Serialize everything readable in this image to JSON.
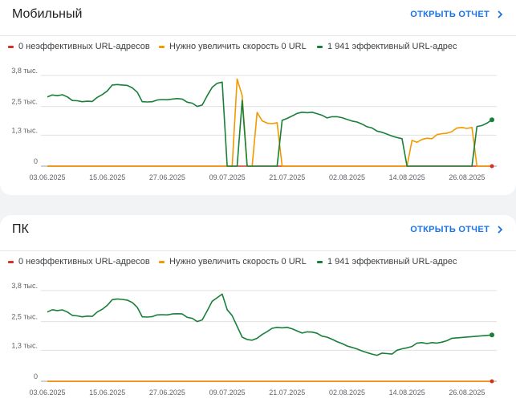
{
  "colors": {
    "ineffective": "#d93025",
    "improve": "#f29900",
    "effective": "#188038",
    "link": "#1a73e8"
  },
  "icons": {
    "open_report": "chevron-right-icon"
  },
  "cards": [
    {
      "title": "Мобильный",
      "open_report_label": "ОТКРЫТЬ ОТЧЕТ",
      "legend": [
        "0 неэффективных URL-адресов",
        "Нужно увеличить скорость 0 URL",
        "1 941 эффективный URL-адрес"
      ],
      "chart_data": {
        "type": "line",
        "x_tick_labels": [
          "03.06.2025",
          "15.06.2025",
          "27.06.2025",
          "09.07.2025",
          "21.07.2025",
          "02.08.2025",
          "14.08.2025",
          "26.08.2025"
        ],
        "y_tick_labels": [
          "3,8 тыс.",
          "2,5 тыс.",
          "1,3 тыс.",
          "0"
        ],
        "y_tick_values": [
          3800,
          2500,
          1300,
          0
        ],
        "ylim": [
          0,
          4000
        ],
        "grid": true,
        "legend_position": "top",
        "series": [
          {
            "name": "0 неэффективных URL-адресов",
            "color": "#d93025",
            "points": [
              [
                "03.06.2025",
                0
              ],
              [
                "31.08.2025",
                0
              ]
            ]
          },
          {
            "name": "Нужно увеличить скорость 0 URL",
            "color": "#f29900",
            "points": [
              [
                "03.06.2025",
                0
              ],
              [
                "10.07.2025",
                0
              ],
              [
                "11.07.2025",
                3650
              ],
              [
                "12.07.2025",
                2950
              ],
              [
                "13.07.2025",
                0
              ],
              [
                "14.07.2025",
                0
              ],
              [
                "15.07.2025",
                2250
              ],
              [
                "16.07.2025",
                1900
              ],
              [
                "17.07.2025",
                1800
              ],
              [
                "18.07.2025",
                1780
              ],
              [
                "19.07.2025",
                1820
              ],
              [
                "20.07.2025",
                0
              ],
              [
                "14.08.2025",
                0
              ],
              [
                "15.08.2025",
                1080
              ],
              [
                "16.08.2025",
                1000
              ],
              [
                "17.08.2025",
                1120
              ],
              [
                "18.08.2025",
                1170
              ],
              [
                "19.08.2025",
                1150
              ],
              [
                "20.08.2025",
                1320
              ],
              [
                "21.08.2025",
                1360
              ],
              [
                "22.08.2025",
                1380
              ],
              [
                "23.08.2025",
                1450
              ],
              [
                "24.08.2025",
                1600
              ],
              [
                "25.08.2025",
                1620
              ],
              [
                "26.08.2025",
                1580
              ],
              [
                "27.08.2025",
                1620
              ],
              [
                "28.08.2025",
                0
              ],
              [
                "31.08.2025",
                0
              ]
            ]
          },
          {
            "name": "1 941 эффективный URL-адрес",
            "color": "#188038",
            "points": [
              [
                "03.06.2025",
                2900
              ],
              [
                "04.06.2025",
                2980
              ],
              [
                "05.06.2025",
                2950
              ],
              [
                "06.06.2025",
                2990
              ],
              [
                "07.06.2025",
                2900
              ],
              [
                "08.06.2025",
                2750
              ],
              [
                "09.06.2025",
                2740
              ],
              [
                "10.06.2025",
                2700
              ],
              [
                "11.06.2025",
                2720
              ],
              [
                "12.06.2025",
                2710
              ],
              [
                "13.06.2025",
                2880
              ],
              [
                "14.06.2025",
                3000
              ],
              [
                "15.06.2025",
                3150
              ],
              [
                "16.06.2025",
                3400
              ],
              [
                "17.06.2025",
                3420
              ],
              [
                "18.06.2025",
                3400
              ],
              [
                "19.06.2025",
                3380
              ],
              [
                "20.06.2025",
                3280
              ],
              [
                "21.06.2025",
                3100
              ],
              [
                "22.06.2025",
                2700
              ],
              [
                "23.06.2025",
                2690
              ],
              [
                "24.06.2025",
                2700
              ],
              [
                "25.06.2025",
                2770
              ],
              [
                "26.06.2025",
                2790
              ],
              [
                "27.06.2025",
                2780
              ],
              [
                "28.06.2025",
                2810
              ],
              [
                "29.06.2025",
                2830
              ],
              [
                "30.06.2025",
                2810
              ],
              [
                "01.07.2025",
                2680
              ],
              [
                "02.07.2025",
                2640
              ],
              [
                "03.07.2025",
                2500
              ],
              [
                "04.07.2025",
                2560
              ],
              [
                "05.07.2025",
                2950
              ],
              [
                "06.07.2025",
                3300
              ],
              [
                "07.07.2025",
                3470
              ],
              [
                "08.07.2025",
                3520
              ],
              [
                "09.07.2025",
                0
              ],
              [
                "11.07.2025",
                0
              ],
              [
                "12.07.2025",
                2750
              ],
              [
                "13.07.2025",
                0
              ],
              [
                "19.07.2025",
                0
              ],
              [
                "20.07.2025",
                1920
              ],
              [
                "21.07.2025",
                2000
              ],
              [
                "22.07.2025",
                2100
              ],
              [
                "23.07.2025",
                2210
              ],
              [
                "24.07.2025",
                2260
              ],
              [
                "25.07.2025",
                2240
              ],
              [
                "26.07.2025",
                2260
              ],
              [
                "27.07.2025",
                2200
              ],
              [
                "28.07.2025",
                2130
              ],
              [
                "29.07.2025",
                2020
              ],
              [
                "30.07.2025",
                2070
              ],
              [
                "31.07.2025",
                2070
              ],
              [
                "01.08.2025",
                2030
              ],
              [
                "02.08.2025",
                1960
              ],
              [
                "03.08.2025",
                1890
              ],
              [
                "04.08.2025",
                1850
              ],
              [
                "05.08.2025",
                1760
              ],
              [
                "06.08.2025",
                1650
              ],
              [
                "07.08.2025",
                1600
              ],
              [
                "08.08.2025",
                1470
              ],
              [
                "09.08.2025",
                1420
              ],
              [
                "10.08.2025",
                1340
              ],
              [
                "11.08.2025",
                1260
              ],
              [
                "12.08.2025",
                1200
              ],
              [
                "13.08.2025",
                1150
              ],
              [
                "14.08.2025",
                0
              ],
              [
                "27.08.2025",
                0
              ],
              [
                "28.08.2025",
                1660
              ],
              [
                "29.08.2025",
                1700
              ],
              [
                "30.08.2025",
                1800
              ],
              [
                "31.08.2025",
                1941
              ]
            ]
          }
        ]
      }
    },
    {
      "title": "ПК",
      "open_report_label": "ОТКРЫТЬ ОТЧЕТ",
      "legend": [
        "0 неэффективных URL-адресов",
        "Нужно увеличить скорость 0 URL",
        "1 941 эффективный URL-адрес"
      ],
      "chart_data": {
        "type": "line",
        "x_tick_labels": [
          "03.06.2025",
          "15.06.2025",
          "27.06.2025",
          "09.07.2025",
          "21.07.2025",
          "02.08.2025",
          "14.08.2025",
          "26.08.2025"
        ],
        "y_tick_labels": [
          "3,8 тыс.",
          "2,5 тыс.",
          "1,3 тыс.",
          "0"
        ],
        "y_tick_values": [
          3800,
          2500,
          1300,
          0
        ],
        "ylim": [
          0,
          4000
        ],
        "grid": true,
        "legend_position": "top",
        "series": [
          {
            "name": "0 неэффективных URL-адресов",
            "color": "#d93025",
            "points": [
              [
                "03.06.2025",
                0
              ],
              [
                "31.08.2025",
                0
              ]
            ]
          },
          {
            "name": "Нужно увеличить скорость 0 URL",
            "color": "#f29900",
            "points": [
              [
                "03.06.2025",
                0
              ],
              [
                "31.08.2025",
                0
              ]
            ]
          },
          {
            "name": "1 941 эффективный URL-адрес",
            "color": "#188038",
            "points": [
              [
                "03.06.2025",
                2900
              ],
              [
                "04.06.2025",
                3000
              ],
              [
                "05.06.2025",
                2960
              ],
              [
                "06.06.2025",
                2990
              ],
              [
                "07.06.2025",
                2900
              ],
              [
                "08.06.2025",
                2760
              ],
              [
                "09.06.2025",
                2740
              ],
              [
                "10.06.2025",
                2700
              ],
              [
                "11.06.2025",
                2730
              ],
              [
                "12.06.2025",
                2720
              ],
              [
                "13.06.2025",
                2900
              ],
              [
                "14.06.2025",
                3020
              ],
              [
                "15.06.2025",
                3180
              ],
              [
                "16.06.2025",
                3420
              ],
              [
                "17.06.2025",
                3450
              ],
              [
                "18.06.2025",
                3430
              ],
              [
                "19.06.2025",
                3400
              ],
              [
                "20.06.2025",
                3300
              ],
              [
                "21.06.2025",
                3100
              ],
              [
                "22.06.2025",
                2700
              ],
              [
                "23.06.2025",
                2690
              ],
              [
                "24.06.2025",
                2710
              ],
              [
                "25.06.2025",
                2780
              ],
              [
                "26.06.2025",
                2790
              ],
              [
                "27.06.2025",
                2780
              ],
              [
                "28.06.2025",
                2820
              ],
              [
                "29.06.2025",
                2830
              ],
              [
                "30.06.2025",
                2820
              ],
              [
                "01.07.2025",
                2680
              ],
              [
                "02.07.2025",
                2640
              ],
              [
                "03.07.2025",
                2500
              ],
              [
                "04.07.2025",
                2570
              ],
              [
                "05.07.2025",
                2950
              ],
              [
                "06.07.2025",
                3350
              ],
              [
                "07.07.2025",
                3500
              ],
              [
                "08.07.2025",
                3650
              ],
              [
                "09.07.2025",
                3000
              ],
              [
                "10.07.2025",
                2750
              ],
              [
                "11.07.2025",
                2300
              ],
              [
                "12.07.2025",
                1850
              ],
              [
                "13.07.2025",
                1750
              ],
              [
                "14.07.2025",
                1720
              ],
              [
                "15.07.2025",
                1800
              ],
              [
                "16.07.2025",
                1960
              ],
              [
                "17.07.2025",
                2080
              ],
              [
                "18.07.2025",
                2220
              ],
              [
                "19.07.2025",
                2260
              ],
              [
                "20.07.2025",
                2240
              ],
              [
                "21.07.2025",
                2260
              ],
              [
                "22.07.2025",
                2200
              ],
              [
                "23.07.2025",
                2110
              ],
              [
                "24.07.2025",
                2020
              ],
              [
                "25.07.2025",
                2070
              ],
              [
                "26.07.2025",
                2060
              ],
              [
                "27.07.2025",
                2010
              ],
              [
                "28.07.2025",
                1890
              ],
              [
                "29.07.2025",
                1850
              ],
              [
                "30.07.2025",
                1760
              ],
              [
                "31.07.2025",
                1660
              ],
              [
                "01.08.2025",
                1580
              ],
              [
                "02.08.2025",
                1480
              ],
              [
                "03.08.2025",
                1420
              ],
              [
                "04.08.2025",
                1350
              ],
              [
                "05.08.2025",
                1270
              ],
              [
                "06.08.2025",
                1200
              ],
              [
                "07.08.2025",
                1140
              ],
              [
                "08.08.2025",
                1090
              ],
              [
                "09.08.2025",
                1180
              ],
              [
                "10.08.2025",
                1160
              ],
              [
                "11.08.2025",
                1140
              ],
              [
                "12.08.2025",
                1300
              ],
              [
                "13.08.2025",
                1360
              ],
              [
                "14.08.2025",
                1400
              ],
              [
                "15.08.2025",
                1460
              ],
              [
                "16.08.2025",
                1600
              ],
              [
                "17.08.2025",
                1620
              ],
              [
                "18.08.2025",
                1580
              ],
              [
                "19.08.2025",
                1620
              ],
              [
                "20.08.2025",
                1600
              ],
              [
                "21.08.2025",
                1640
              ],
              [
                "22.08.2025",
                1700
              ],
              [
                "23.08.2025",
                1800
              ],
              [
                "31.08.2025",
                1941
              ]
            ]
          }
        ]
      }
    }
  ]
}
